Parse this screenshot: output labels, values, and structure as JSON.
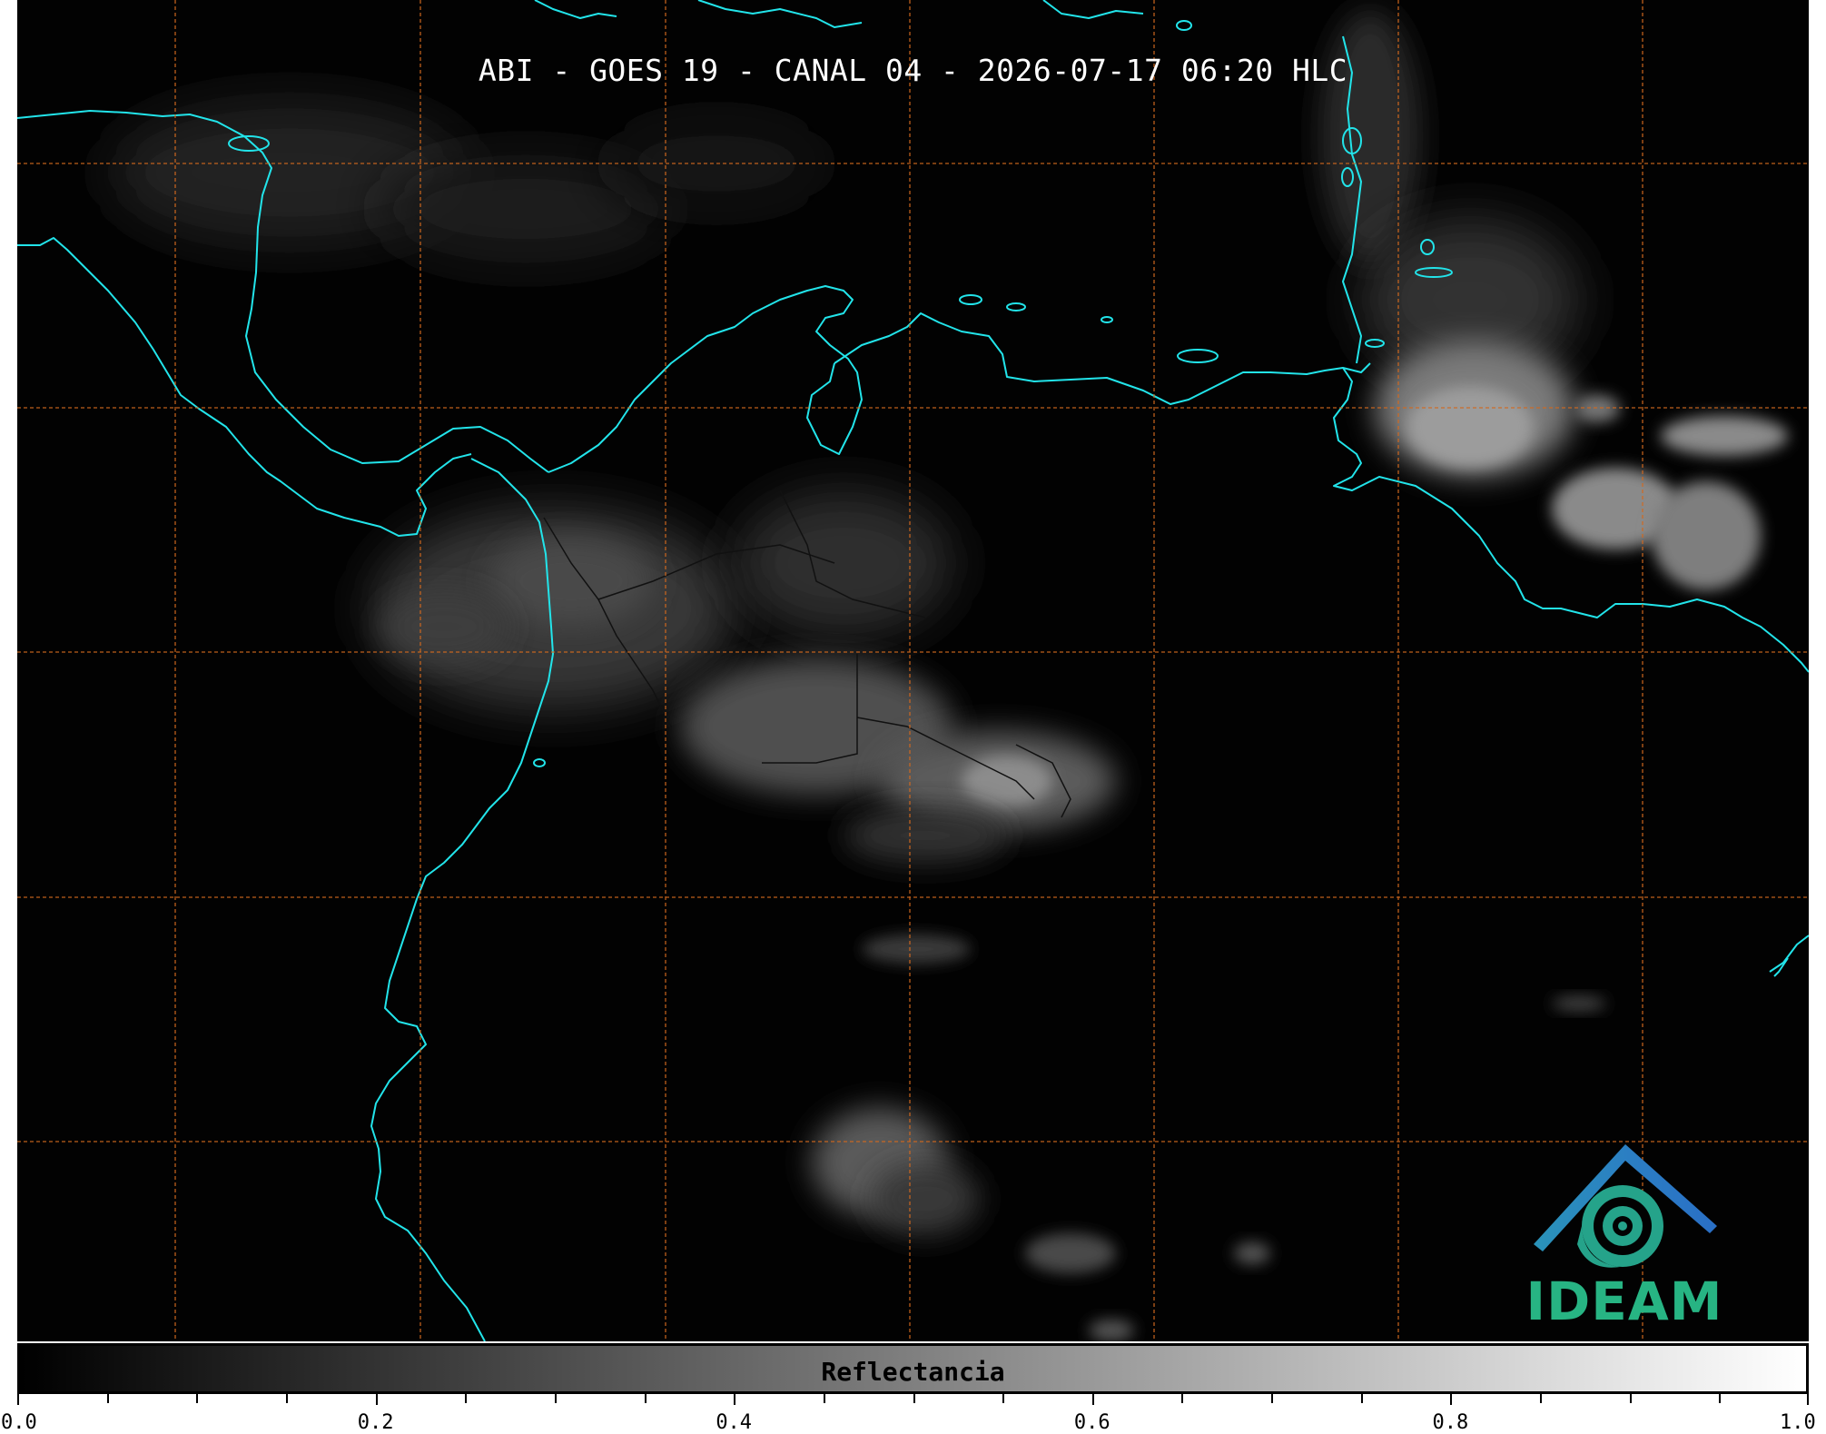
{
  "title": "ABI - GOES 19 - CANAL 04 - 2026-07-17 06:20 HLC",
  "colorbar": {
    "label": "Reflectancia",
    "ticks": [
      "0.0",
      "0.2",
      "0.4",
      "0.6",
      "0.8",
      "1.0"
    ],
    "min": 0.0,
    "max": 1.0,
    "colormap": "grayscale black-to-white"
  },
  "logo": {
    "text": "IDEAM",
    "text_color": "#27b483",
    "roof_color": "#2b7fc3",
    "swirl_color": "#25a38a"
  },
  "colors": {
    "coastline": "#22e4ea",
    "gridline": "#d2691e",
    "background": "#020202",
    "borders": "#111111"
  },
  "grid": {
    "style": "dashed",
    "visible": true
  }
}
